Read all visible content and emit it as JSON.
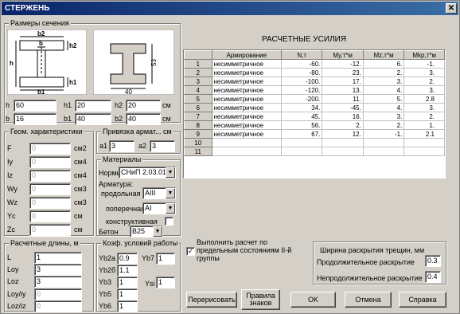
{
  "window": {
    "title": "СТЕРЖЕНЬ"
  },
  "section": {
    "title": "Размеры сечения",
    "diagram_labels": {
      "b2": "b2",
      "b": "b",
      "h2": "h2",
      "h": "h",
      "h1": "h1",
      "b1": "b1",
      "dim_53": "53",
      "dim_40": "40"
    },
    "fields": [
      {
        "label": "h",
        "value": "60"
      },
      {
        "label": "h1",
        "value": "20"
      },
      {
        "label": "h2",
        "value": "20"
      },
      {
        "label": "b",
        "value": "16"
      },
      {
        "label": "b1",
        "value": "40"
      },
      {
        "label": "b2",
        "value": "40"
      }
    ],
    "unit": "см"
  },
  "geometry": {
    "title": "Геом. характеристики",
    "rows": [
      {
        "label": "F",
        "value": "0",
        "unit": "см2"
      },
      {
        "label": "Iy",
        "value": "0",
        "unit": "см4"
      },
      {
        "label": "Iz",
        "value": "0",
        "unit": "см4"
      },
      {
        "label": "Wy",
        "value": "0",
        "unit": "см3"
      },
      {
        "label": "Wz",
        "value": "0",
        "unit": "см3"
      },
      {
        "label": "Yc",
        "value": "0",
        "unit": "см"
      },
      {
        "label": "Zc",
        "value": "0",
        "unit": "см"
      }
    ]
  },
  "anchor": {
    "title": "Привязка армат... см",
    "a1_label": "a1",
    "a1": "3",
    "a2_label": "a2",
    "a2": "3"
  },
  "materials": {
    "title": "Материалы",
    "norms_label": "Нормы",
    "norms": "СНиП 2.03.01",
    "rebar_label": "Арматура:",
    "long_label": "продольная",
    "long": "AIII",
    "trans_label": "поперечная",
    "trans": "AI",
    "constr_label": "конструктивная",
    "concrete_label": "Бетон",
    "concrete": "B25"
  },
  "lengths": {
    "title": "Расчетные длины, м",
    "rows": [
      {
        "label": "L",
        "value": "1",
        "disabled": false
      },
      {
        "label": "Loy",
        "value": "3",
        "disabled": false
      },
      {
        "label": "Loz",
        "value": "3",
        "disabled": false
      },
      {
        "label": "Loy/iy",
        "value": "0",
        "disabled": true
      },
      {
        "label": "Loz/iz",
        "value": "0",
        "disabled": true
      }
    ]
  },
  "coef": {
    "title": "Коэф. условий работы",
    "left": [
      {
        "label": "Yb2a",
        "value": "0.9"
      },
      {
        "label": "Yb2б",
        "value": "1.1"
      },
      {
        "label": "Yb3",
        "value": "1"
      },
      {
        "label": "Yb5",
        "value": "1"
      },
      {
        "label": "Yb6",
        "value": "1"
      }
    ],
    "yb7_label": "Yb7",
    "yb7": "1",
    "ysi_label": "Ysi",
    "ysi": "1"
  },
  "forces": {
    "title": "РАСЧЕТНЫЕ УСИЛИЯ",
    "columns": [
      "",
      "Армирование",
      "N,т",
      "My,т*м",
      "Mz,т*м",
      "Mkp,т*м"
    ],
    "rows": [
      [
        "1",
        "несимметричное",
        "-60.",
        "-12.",
        "6.",
        "-1."
      ],
      [
        "2",
        "несимметричное",
        "-80.",
        "23.",
        "2.",
        "3."
      ],
      [
        "3",
        "несимметричное",
        "-100.",
        "17.",
        "3.",
        "2."
      ],
      [
        "4",
        "несимметричное",
        "-120.",
        "13.",
        "4.",
        "3."
      ],
      [
        "5",
        "несимметричное",
        "-200.",
        "11.",
        "5.",
        "2.8"
      ],
      [
        "6",
        "несимметричное",
        "34.",
        "-45.",
        "4.",
        "3."
      ],
      [
        "7",
        "несимметричное",
        "45.",
        "16.",
        "3.",
        "2."
      ],
      [
        "8",
        "несимметричное",
        "56.",
        "2.",
        "2.",
        "1."
      ],
      [
        "9",
        "несимметричное",
        "67.",
        "12.",
        "-1.",
        "2.1"
      ],
      [
        "10",
        "",
        "",
        "",
        "",
        ""
      ],
      [
        "11",
        "",
        "",
        "",
        "",
        ""
      ]
    ]
  },
  "calc_option": {
    "checked": "✓",
    "label": "Выполнить расчет по предельным состояниям II-й группы"
  },
  "crack": {
    "title": "Ширина раскрытия трещин, мм",
    "long_label": "Продолжительное раскрытие",
    "long": "0.3",
    "short_label": "Непродолжительное раскрытие",
    "short": "0.4"
  },
  "buttons": {
    "redraw": "Перерисовать",
    "signs": "Правила знаков",
    "ok": "OK",
    "cancel": "Отмена",
    "help": "Справка"
  }
}
